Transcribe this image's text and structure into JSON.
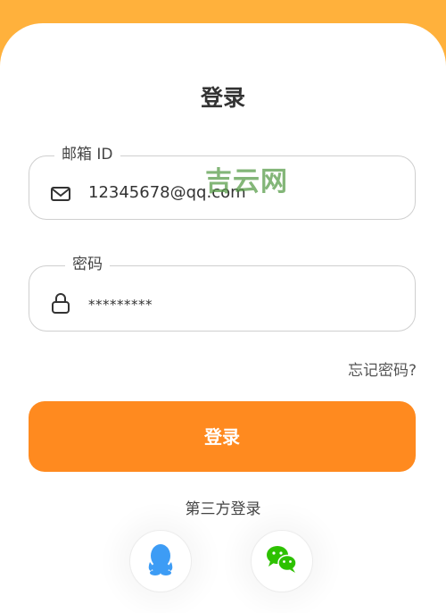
{
  "title": "登录",
  "email": {
    "legend": "邮箱 ID",
    "value": "12345678@qq.com",
    "icon": "mail-icon"
  },
  "password": {
    "legend": "密码",
    "value": "*********",
    "icon": "lock-icon"
  },
  "watermark": "吉云网",
  "forgot": "忘记密码?",
  "login_button": "登录",
  "third_party": {
    "title": "第三方登录",
    "providers": [
      "qq-icon",
      "wechat-icon"
    ]
  },
  "colors": {
    "header": "#ffb13c",
    "button": "#ff8a1f",
    "wechat": "#2dc100",
    "qq": "#3d9cf5"
  }
}
